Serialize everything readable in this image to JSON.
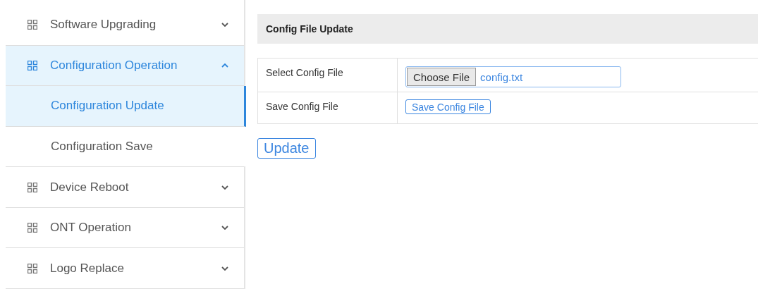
{
  "sidebar": {
    "items": [
      {
        "label": "Software Upgrading",
        "expanded": false
      },
      {
        "label": "Configuration Operation",
        "expanded": true,
        "children": [
          {
            "label": "Configuration Update",
            "selected": true
          },
          {
            "label": "Configuration Save",
            "selected": false
          }
        ]
      },
      {
        "label": "Device Reboot",
        "expanded": false
      },
      {
        "label": "ONT Operation",
        "expanded": false
      },
      {
        "label": "Logo Replace",
        "expanded": false
      }
    ]
  },
  "panel": {
    "title": "Config File Update",
    "rows": [
      {
        "kind": "file",
        "label": "Select Config File",
        "button": "Choose File",
        "value": "config.txt"
      },
      {
        "kind": "button",
        "label": "Save Config File",
        "button": "Save Config File"
      }
    ],
    "submit": "Update"
  }
}
